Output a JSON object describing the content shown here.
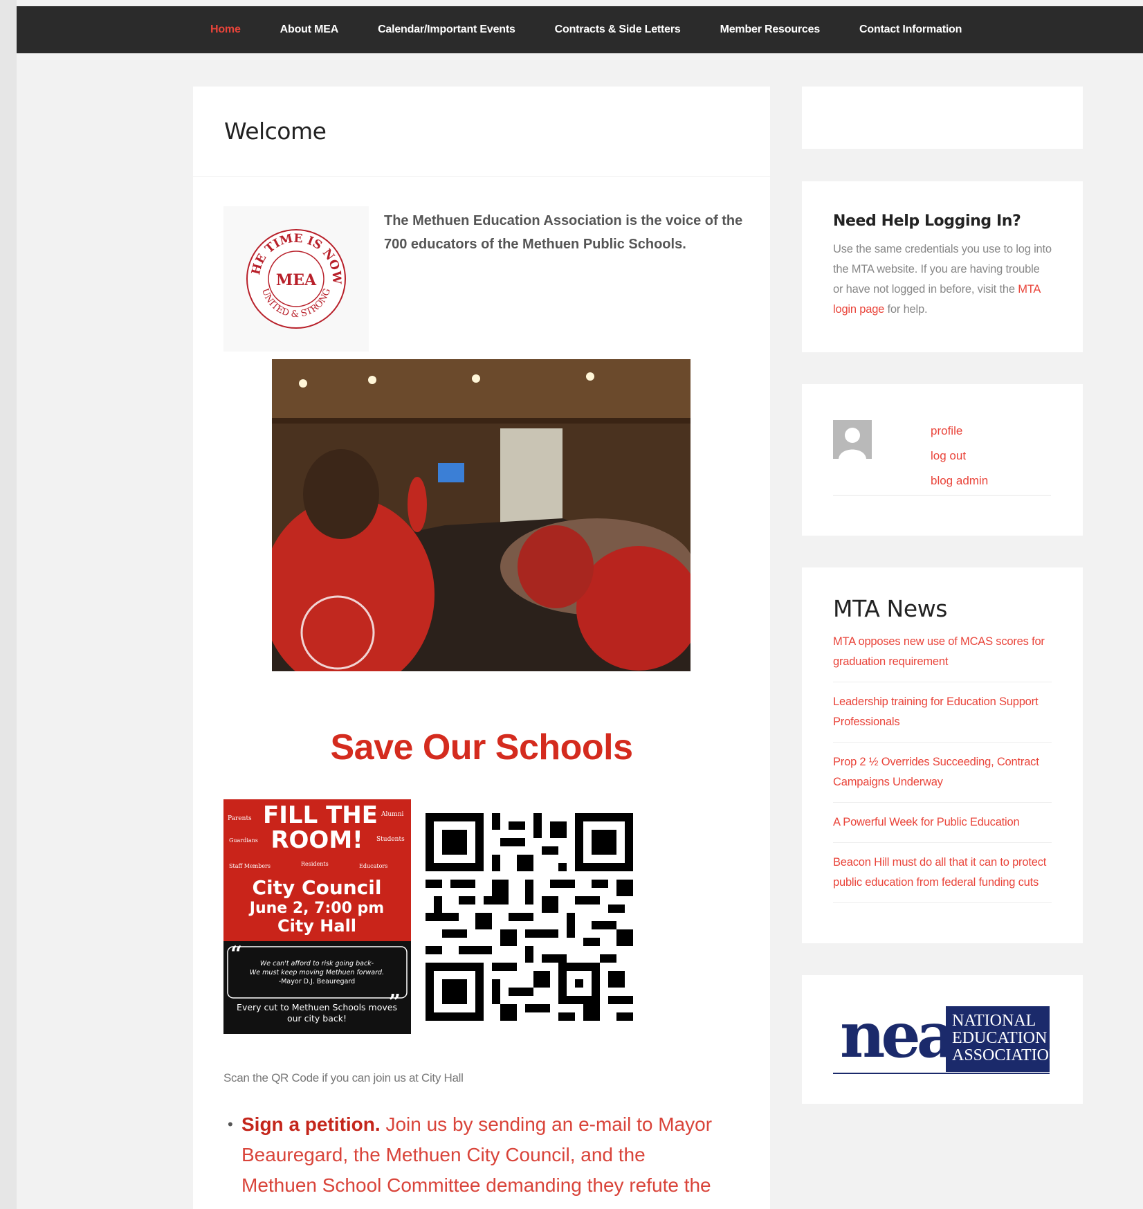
{
  "nav": {
    "items": [
      {
        "label": "Home",
        "active": true
      },
      {
        "label": "About MEA",
        "active": false
      },
      {
        "label": "Calendar/Important Events",
        "active": false
      },
      {
        "label": "Contracts & Side Letters",
        "active": false
      },
      {
        "label": "Member Resources",
        "active": false
      },
      {
        "label": "Contact Information",
        "active": false
      }
    ]
  },
  "main": {
    "title": "Welcome",
    "intro": "The Methuen Education Association is the voice of the 700 educators of the Methuen Public Schools.",
    "logo": {
      "top_text": "THE TIME IS NOW",
      "center_text": "MEA",
      "bottom_text": "UNITED & STRONG"
    },
    "photo_alt": "Crowd of MEA members in red hoodies at a City Council meeting",
    "save_title": "Save Our Schools",
    "flyer": {
      "headline1": "FILL THE",
      "headline2": "ROOM!",
      "tags": [
        "Parents",
        "Alumni",
        "Guardians",
        "Students",
        "Staff Members",
        "Residents",
        "Educators"
      ],
      "event": "City Council",
      "date": "June 2, 7:00 pm",
      "place": "City Hall",
      "quote": "We can't afford to risk going back- We must keep moving Methuen forward.",
      "quote_author": "-Mayor D.J. Beauregard",
      "footer": "Every cut to Methuen Schools moves our city back!"
    },
    "scan_caption": "Scan the QR Code if you can join us at City Hall",
    "petition": {
      "lead": "Sign a petition.",
      "text": " Join us by sending an e-mail to Mayor Beauregard, the Methuen City Council, and the Methuen School Committee demanding they refute the"
    }
  },
  "sidebar": {
    "help": {
      "title": "Need Help Logging In?",
      "text_before": "Use the same credentials you use to log into the MTA website. If you are having trouble or have not logged in before, visit the ",
      "link": "MTA login page",
      "text_after": " for help."
    },
    "account": {
      "links": [
        "profile",
        "log out",
        "blog admin"
      ]
    },
    "news": {
      "title": "MTA News",
      "items": [
        "MTA opposes new use of MCAS scores for graduation requirement",
        "Leadership training for Education Support Professionals",
        "Prop 2 ½ Overrides Succeeding, Contract Campaigns Underway",
        "A Powerful Week for Public Education",
        "Beacon Hill must do all that it can to protect public education from federal funding cuts"
      ]
    },
    "nea": {
      "wordmark": "nea",
      "line1": "NATIONAL",
      "line2": "EDUCATION",
      "line3": "ASSOCIATION"
    }
  },
  "colors": {
    "accent": "#e9443a",
    "nav_bg": "#2b2b2b",
    "red_title": "#d42b1e",
    "nea_blue": "#1b2a6b"
  }
}
